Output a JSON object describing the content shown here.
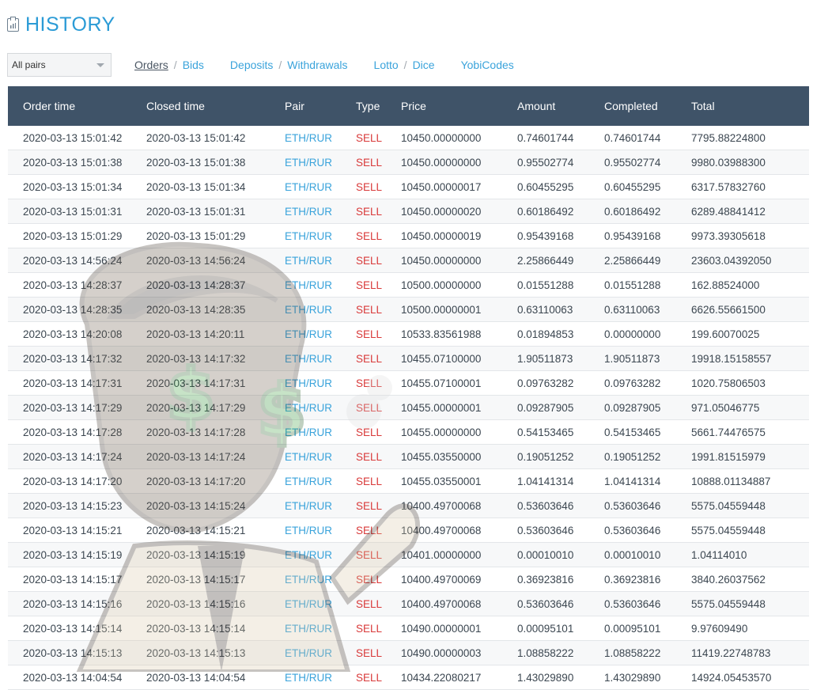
{
  "header": {
    "title": "HISTORY"
  },
  "filter": {
    "selected": "All pairs"
  },
  "nav": {
    "orders": "Orders",
    "bids": "Bids",
    "deposits": "Deposits",
    "withdrawals": "Withdrawals",
    "lotto": "Lotto",
    "dice": "Dice",
    "yobicodes": "YobiCodes",
    "separator": "/"
  },
  "table": {
    "columns": [
      "Order time",
      "Closed time",
      "Pair",
      "Type",
      "Price",
      "Amount",
      "Completed",
      "Total"
    ],
    "rows": [
      [
        "2020-03-13 15:01:42",
        "2020-03-13 15:01:42",
        "ETH/RUR",
        "SELL",
        "10450.00000000",
        "0.74601744",
        "0.74601744",
        "7795.88224800"
      ],
      [
        "2020-03-13 15:01:38",
        "2020-03-13 15:01:38",
        "ETH/RUR",
        "SELL",
        "10450.00000000",
        "0.95502774",
        "0.95502774",
        "9980.03988300"
      ],
      [
        "2020-03-13 15:01:34",
        "2020-03-13 15:01:34",
        "ETH/RUR",
        "SELL",
        "10450.00000017",
        "0.60455295",
        "0.60455295",
        "6317.57832760"
      ],
      [
        "2020-03-13 15:01:31",
        "2020-03-13 15:01:31",
        "ETH/RUR",
        "SELL",
        "10450.00000020",
        "0.60186492",
        "0.60186492",
        "6289.48841412"
      ],
      [
        "2020-03-13 15:01:29",
        "2020-03-13 15:01:29",
        "ETH/RUR",
        "SELL",
        "10450.00000019",
        "0.95439168",
        "0.95439168",
        "9973.39305618"
      ],
      [
        "2020-03-13 14:56:24",
        "2020-03-13 14:56:24",
        "ETH/RUR",
        "SELL",
        "10450.00000000",
        "2.25866449",
        "2.25866449",
        "23603.04392050"
      ],
      [
        "2020-03-13 14:28:37",
        "2020-03-13 14:28:37",
        "ETH/RUR",
        "SELL",
        "10500.00000000",
        "0.01551288",
        "0.01551288",
        "162.88524000"
      ],
      [
        "2020-03-13 14:28:35",
        "2020-03-13 14:28:35",
        "ETH/RUR",
        "SELL",
        "10500.00000001",
        "0.63110063",
        "0.63110063",
        "6626.55661500"
      ],
      [
        "2020-03-13 14:20:08",
        "2020-03-13 14:20:11",
        "ETH/RUR",
        "SELL",
        "10533.83561988",
        "0.01894853",
        "0.00000000",
        "199.60070025"
      ],
      [
        "2020-03-13 14:17:32",
        "2020-03-13 14:17:32",
        "ETH/RUR",
        "SELL",
        "10455.07100000",
        "1.90511873",
        "1.90511873",
        "19918.15158557"
      ],
      [
        "2020-03-13 14:17:31",
        "2020-03-13 14:17:31",
        "ETH/RUR",
        "SELL",
        "10455.07100001",
        "0.09763282",
        "0.09763282",
        "1020.75806503"
      ],
      [
        "2020-03-13 14:17:29",
        "2020-03-13 14:17:29",
        "ETH/RUR",
        "SELL",
        "10455.00000001",
        "0.09287905",
        "0.09287905",
        "971.05046775"
      ],
      [
        "2020-03-13 14:17:28",
        "2020-03-13 14:17:28",
        "ETH/RUR",
        "SELL",
        "10455.00000000",
        "0.54153465",
        "0.54153465",
        "5661.74476575"
      ],
      [
        "2020-03-13 14:17:24",
        "2020-03-13 14:17:24",
        "ETH/RUR",
        "SELL",
        "10455.03550000",
        "0.19051252",
        "0.19051252",
        "1991.81515979"
      ],
      [
        "2020-03-13 14:17:20",
        "2020-03-13 14:17:20",
        "ETH/RUR",
        "SELL",
        "10455.03550001",
        "1.04141314",
        "1.04141314",
        "10888.01134887"
      ],
      [
        "2020-03-13 14:15:23",
        "2020-03-13 14:15:24",
        "ETH/RUR",
        "SELL",
        "10400.49700068",
        "0.53603646",
        "0.53603646",
        "5575.04559448"
      ],
      [
        "2020-03-13 14:15:21",
        "2020-03-13 14:15:21",
        "ETH/RUR",
        "SELL",
        "10400.49700068",
        "0.53603646",
        "0.53603646",
        "5575.04559448"
      ],
      [
        "2020-03-13 14:15:19",
        "2020-03-13 14:15:19",
        "ETH/RUR",
        "SELL",
        "10401.00000000",
        "0.00010010",
        "0.00010010",
        "1.04114010"
      ],
      [
        "2020-03-13 14:15:17",
        "2020-03-13 14:15:17",
        "ETH/RUR",
        "SELL",
        "10400.49700069",
        "0.36923816",
        "0.36923816",
        "3840.26037562"
      ],
      [
        "2020-03-13 14:15:16",
        "2020-03-13 14:15:16",
        "ETH/RUR",
        "SELL",
        "10400.49700068",
        "0.53603646",
        "0.53603646",
        "5575.04559448"
      ],
      [
        "2020-03-13 14:15:14",
        "2020-03-13 14:15:14",
        "ETH/RUR",
        "SELL",
        "10490.00000001",
        "0.00095101",
        "0.00095101",
        "9.97609490"
      ],
      [
        "2020-03-13 14:15:13",
        "2020-03-13 14:15:13",
        "ETH/RUR",
        "SELL",
        "10490.00000003",
        "1.08858222",
        "1.08858222",
        "11419.22748783"
      ],
      [
        "2020-03-13 14:04:54",
        "2020-03-13 14:04:54",
        "ETH/RUR",
        "SELL",
        "10434.22080217",
        "1.43029890",
        "1.43029890",
        "14924.05453570"
      ]
    ]
  },
  "colors": {
    "accent": "#2b9bd6",
    "header_bg": "#3f5368",
    "sell": "#d93a3a",
    "pair": "#3aa3db"
  },
  "icons": {
    "title": "history-clipboard-icon",
    "select": "chevron-down-icon"
  }
}
